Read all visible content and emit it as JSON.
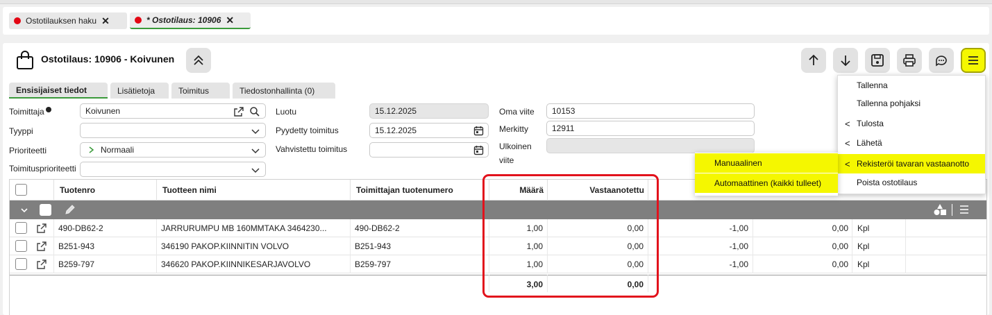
{
  "tabs": [
    {
      "label": "Ostotilauksen haku",
      "close": "✕"
    },
    {
      "label": "* Ostotilaus: 10906",
      "close": "✕"
    }
  ],
  "header": {
    "title": "Ostotilaus: 10906 - Koivunen"
  },
  "subtabs": [
    "Ensisijaiset tiedot",
    "Lisätietoja",
    "Toimitus",
    "Tiedostonhallinta (0)"
  ],
  "form": {
    "toimittaja_label": "Toimittaja",
    "toimittaja_value": "Koivunen",
    "tyyppi_label": "Tyyppi",
    "prioriteetti_label": "Prioriteetti",
    "prioriteetti_value": "Normaali",
    "toimitusprioriteetti_label": "Toimitusprioriteetti",
    "luotu_label": "Luotu",
    "luotu_value": "15.12.2025",
    "pyydetty_label": "Pyydetty toimitus",
    "pyydetty_value": "15.12.2025",
    "vahvistettu_label": "Vahvistettu toimitus",
    "oma_viite_label": "Oma viite",
    "oma_viite_value": "10153",
    "merkitty_label": "Merkitty",
    "merkitty_value": "12911",
    "ulkoinen_label_1": "Ulkoinen",
    "ulkoinen_label_2": "viite"
  },
  "grid": {
    "headers": {
      "tuotenro": "Tuotenro",
      "nimi": "Tuotteen nimi",
      "toim_nro": "Toimittajan tuotenumero",
      "maara": "Määrä",
      "vastaanotettu": "Vastaanotettu"
    },
    "rows": [
      {
        "tuotenro": "490-DB62-2",
        "nimi": "JARRURUMPU MB 160MMTAKA 3464230...",
        "toim_nro": "490-DB62-2",
        "maara": "1,00",
        "vastaanotettu": "0,00",
        "c1": "-1,00",
        "c2": "0,00",
        "unit": "Kpl"
      },
      {
        "tuotenro": "B251-943",
        "nimi": "346190 PAKOP.KIINNITIN VOLVO",
        "toim_nro": "B251-943",
        "maara": "1,00",
        "vastaanotettu": "0,00",
        "c1": "-1,00",
        "c2": "0,00",
        "unit": "Kpl"
      },
      {
        "tuotenro": "B259-797",
        "nimi": "346620 PAKOP.KIINNIKESARJAVOLVO",
        "toim_nro": "B259-797",
        "maara": "1,00",
        "vastaanotettu": "0,00",
        "c1": "-1,00",
        "c2": "0,00",
        "unit": "Kpl"
      }
    ],
    "totals": {
      "maara": "3,00",
      "vastaanotettu": "0,00"
    }
  },
  "menu": {
    "items": [
      "Tallenna",
      "Tallenna pohjaksi",
      "Tulosta",
      "Lähetä",
      "Rekisteröi tavaran vastaanotto",
      "Poista ostotilaus"
    ],
    "chevron": "<"
  },
  "submenu": {
    "items": [
      "Manuaalinen",
      "Automaattinen (kaikki tulleet)"
    ]
  },
  "colors": {
    "highlight": "#f5f700",
    "annotation": "#e2121c",
    "tab_dot": "#e30613",
    "active_tab_underline": "#3a9a3a"
  }
}
